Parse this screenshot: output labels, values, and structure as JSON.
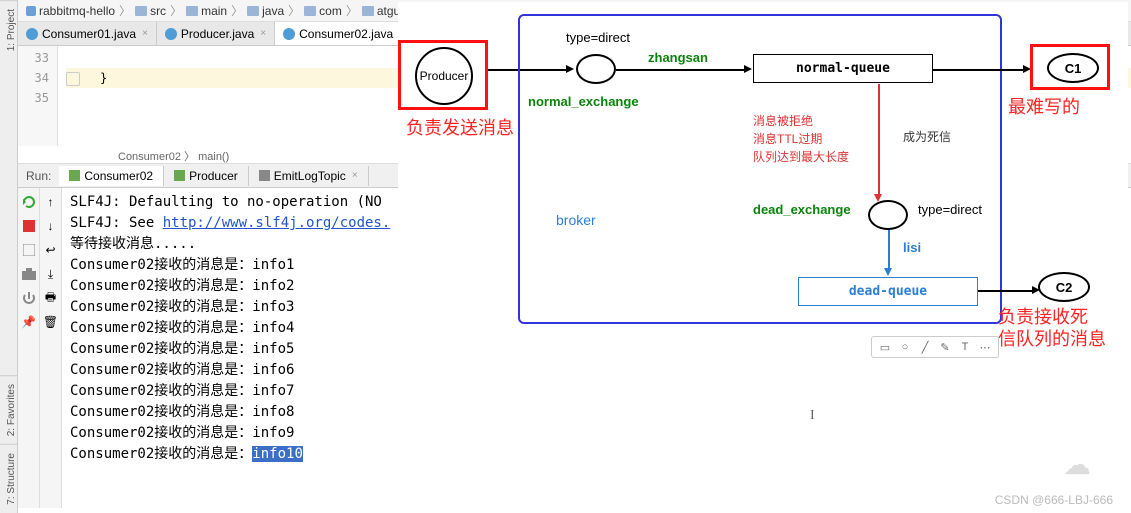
{
  "breadcrumb": [
    "rabbitmq-hello",
    "src",
    "main",
    "java",
    "com",
    "atguigu"
  ],
  "tabs": [
    {
      "label": "Consumer01.java",
      "active": false
    },
    {
      "label": "Producer.java",
      "active": false
    },
    {
      "label": "Consumer02.java",
      "active": true
    }
  ],
  "sidebar_tabs": {
    "project": "1: Project",
    "favorites": "2: Favorites",
    "structure": "7: Structure"
  },
  "editor": {
    "lines": [
      {
        "n": "33",
        "text": ""
      },
      {
        "n": "34",
        "text": "}",
        "hl": true
      },
      {
        "n": "35",
        "text": ""
      }
    ],
    "crumb": "Consumer02 〉 main()"
  },
  "run": {
    "label": "Run:",
    "tabs": [
      {
        "label": "Consumer02",
        "active": true
      },
      {
        "label": "Producer",
        "active": false
      },
      {
        "label": "EmitLogTopic",
        "active": false
      }
    ]
  },
  "console": [
    {
      "t": "SLF4J: Defaulting to no-operation (NO"
    },
    {
      "prefix": "SLF4J: See ",
      "link": "http://www.slf4j.org/codes."
    },
    {
      "t": "等待接收消息....."
    },
    {
      "t": "Consumer02接收的消息是：info1"
    },
    {
      "t": "Consumer02接收的消息是：info2"
    },
    {
      "t": "Consumer02接收的消息是：info3"
    },
    {
      "t": "Consumer02接收的消息是：info4"
    },
    {
      "t": "Consumer02接收的消息是：info5"
    },
    {
      "t": "Consumer02接收的消息是：info6"
    },
    {
      "t": "Consumer02接收的消息是：info7"
    },
    {
      "t": "Consumer02接收的消息是：info8"
    },
    {
      "t": "Consumer02接收的消息是：info9"
    },
    {
      "prefix": "Consumer02接收的消息是：",
      "sel": "info10"
    }
  ],
  "diagram": {
    "producer": "Producer",
    "producer_caption": "负责发送消息",
    "type_direct": "type=direct",
    "normal_exchange": "normal_exchange",
    "routing_zhangsan": "zhangsan",
    "normal_queue": "normal-queue",
    "reasons": [
      "消息被拒绝",
      "消息TTL过期",
      "队列达到最大长度"
    ],
    "become_dead": "成为死信",
    "dead_exchange": "dead_exchange",
    "type_direct2": "type=direct",
    "routing_lisi": "lisi",
    "dead_queue": "dead-queue",
    "broker": "broker",
    "c1": "C1",
    "c2": "C2",
    "c1_caption": "最难写的",
    "c2_caption_l1": "负责接收死",
    "c2_caption_l2": "信队列的消息"
  },
  "watermark": "CSDN @666-LBJ-666"
}
